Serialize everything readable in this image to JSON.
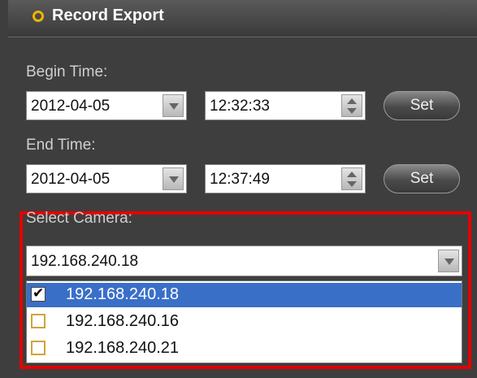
{
  "title": "Record Export",
  "begin": {
    "label": "Begin Time:",
    "date": "2012-04-05",
    "time": "12:32:33",
    "set_label": "Set"
  },
  "end": {
    "label": "End Time:",
    "date": "2012-04-05",
    "time": "12:37:49",
    "set_label": "Set"
  },
  "camera": {
    "label": "Select Camera:",
    "selected": "192.168.240.18",
    "items": [
      {
        "label": "192.168.240.18",
        "checked": true,
        "highlighted": true
      },
      {
        "label": "192.168.240.16",
        "checked": false,
        "highlighted": false
      },
      {
        "label": "192.168.240.21",
        "checked": false,
        "highlighted": false
      }
    ]
  },
  "colors": {
    "accent_dot": "#f0b400",
    "selection": "#3a6fc8",
    "highlight_border": "#e60000"
  }
}
